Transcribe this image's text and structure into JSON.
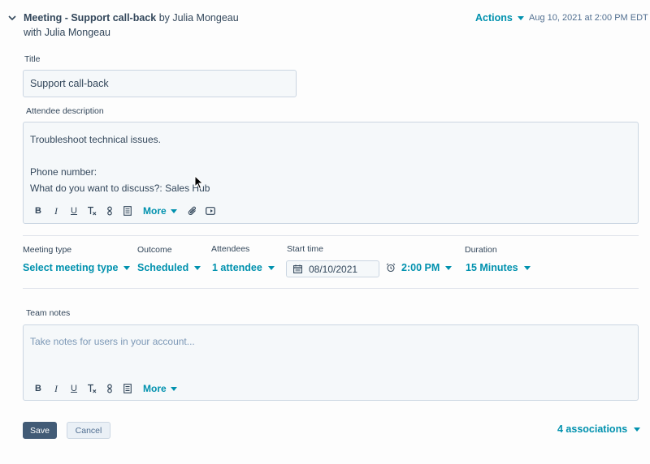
{
  "header": {
    "title_bold": "Meeting - Support call-back",
    "title_rest": " by Julia Mongeau",
    "subtitle": "with Julia Mongeau",
    "actions_label": "Actions",
    "timestamp": "Aug 10, 2021 at 2:00 PM EDT"
  },
  "form": {
    "title_label": "Title",
    "title_value": "Support call-back",
    "description_label": "Attendee description",
    "description_lines": [
      "Troubleshoot technical issues.",
      "Phone number:",
      "What do you want to discuss?: Sales Hub"
    ],
    "toolbar": {
      "bold": "B",
      "italic": "I",
      "underline": "U",
      "clear_format": "T",
      "more_label": "More"
    },
    "fields": {
      "meeting_type_label": "Meeting type",
      "meeting_type_value": "Select meeting type",
      "outcome_label": "Outcome",
      "outcome_value": "Scheduled",
      "attendees_label": "Attendees",
      "attendees_value": "1 attendee",
      "start_time_label": "Start time",
      "start_date_value": "08/10/2021",
      "start_time_value": "2:00 PM",
      "duration_label": "Duration",
      "duration_value": "15 Minutes"
    },
    "team_notes_label": "Team notes",
    "team_notes_placeholder": "Take notes for users in your account..."
  },
  "footer": {
    "save_label": "Save",
    "cancel_label": "Cancel",
    "associations_label": "4 associations"
  },
  "colors": {
    "accent": "#0091ae",
    "text": "#33475b",
    "primary_button": "#425b76",
    "field_bg": "#f5f8fa",
    "border": "#cbd6e2"
  }
}
